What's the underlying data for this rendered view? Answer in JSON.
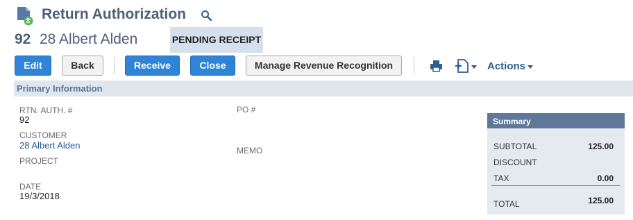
{
  "header": {
    "title": "Return Authorization",
    "record_number": "92",
    "record_name": "28 Albert Alden",
    "status": "PENDING RECEIPT"
  },
  "toolbar": {
    "edit": "Edit",
    "back": "Back",
    "receive": "Receive",
    "close": "Close",
    "manage_revenue": "Manage Revenue Recognition",
    "actions": "Actions"
  },
  "section": {
    "title": "Primary Information"
  },
  "fields": {
    "rtn_auth_label": "RTN. AUTH. #",
    "rtn_auth_value": "92",
    "customer_label": "CUSTOMER",
    "customer_value": "28 Albert Alden",
    "project_label": "PROJECT",
    "date_label": "DATE",
    "date_value": "19/3/2018",
    "po_label": "PO #",
    "memo_label": "MEMO"
  },
  "summary": {
    "title": "Summary",
    "subtotal_label": "SUBTOTAL",
    "subtotal_value": "125.00",
    "discount_label": "DISCOUNT",
    "tax_label": "TAX",
    "tax_value": "0.00",
    "total_label": "TOTAL",
    "total_value": "125.00"
  },
  "colors": {
    "primary_button": "#2f84d8",
    "title_text": "#4d5f79",
    "status_bg": "#d5e0ec",
    "section_bar": "#dfe6ee",
    "summary_header": "#607799",
    "summary_bg": "#e5eaf1",
    "link": "#255a93"
  },
  "icons": [
    "return-document-icon",
    "search-icon",
    "print-icon",
    "new-document-icon",
    "chevron-down-icon"
  ]
}
